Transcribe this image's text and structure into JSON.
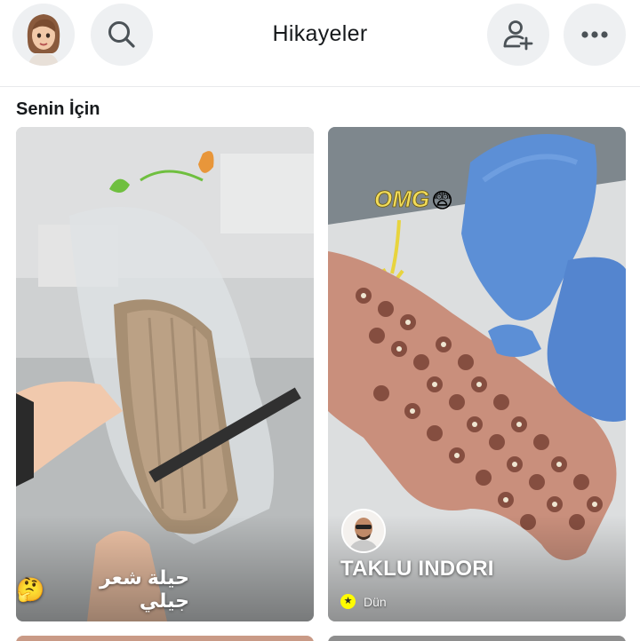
{
  "header": {
    "title": "Hikayeler",
    "profile_icon": "bitmoji-avatar-icon",
    "search_icon": "search-icon",
    "add_friend_icon": "add-friend-icon",
    "more_icon": "more-horizontal-icon"
  },
  "section": {
    "title": "Senin İçin"
  },
  "stories": [
    {
      "caption": "حيلة شعر جيلي",
      "emoji": "🤔",
      "watermark_icon": "brand-logo-watermark"
    },
    {
      "overlay_text": "OMG",
      "overlay_emoji": "😨",
      "creator_name": "TAKLU INDORI",
      "time": "Dün",
      "badge_icon": "star-badge-icon"
    }
  ],
  "colors": {
    "accent_yellow": "#FFFC00",
    "surface": "#EEF0F2",
    "text": "#16191C"
  }
}
